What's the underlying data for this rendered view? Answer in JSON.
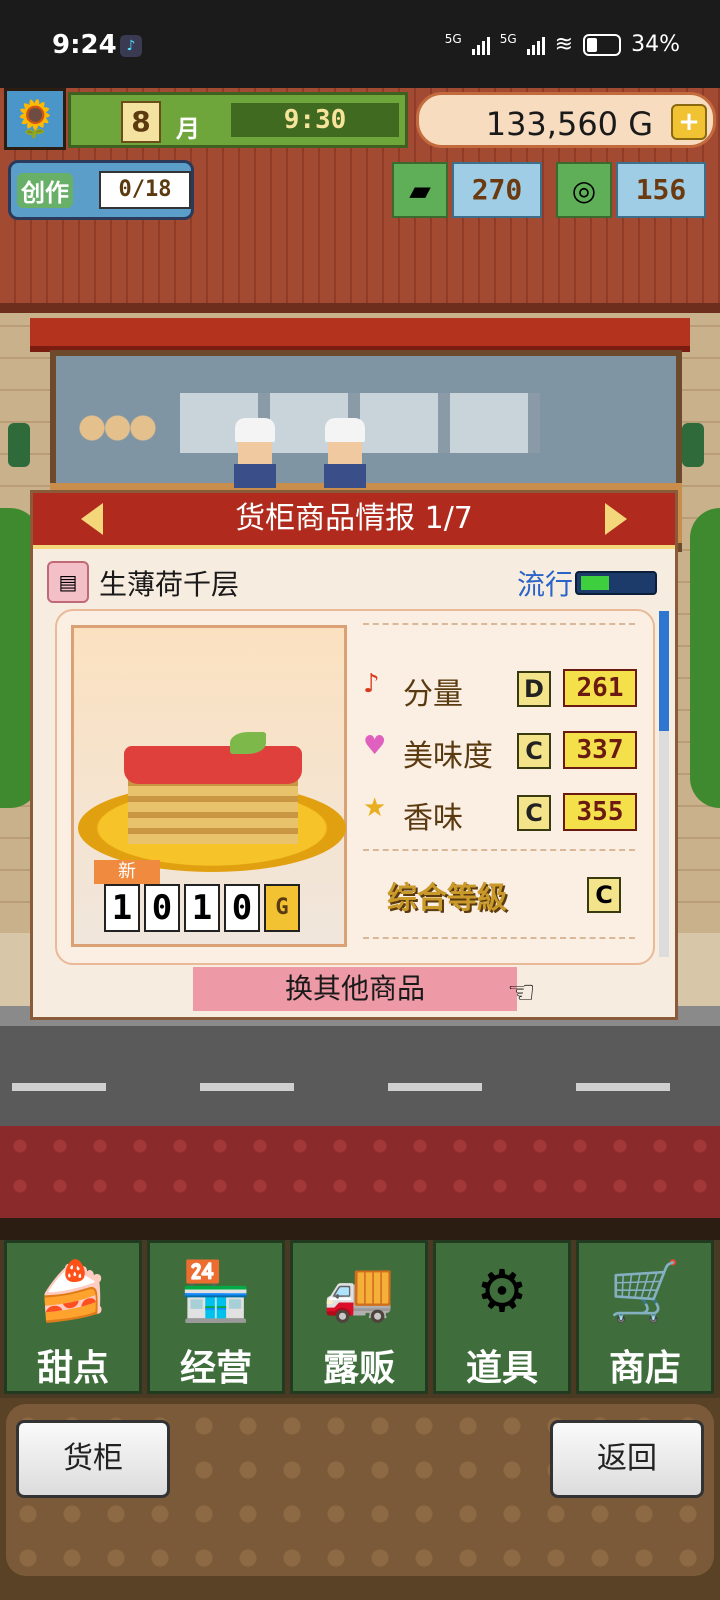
{
  "status_bar": {
    "time": "9:24",
    "network1": "5G",
    "network2": "5G",
    "battery": "34%"
  },
  "hud": {
    "month": "8",
    "month_unit": "月",
    "clock": "9:30",
    "gold": "133,560 G",
    "gold_plus": "+",
    "create_label": "创作",
    "create_count": "0/18",
    "resource1_value": "270",
    "resource2_value": "156"
  },
  "dialog": {
    "title": "货柜商品情报 1/7",
    "item_name": "生薄荷千层",
    "trend_label": "流行",
    "trend_level": 0.4,
    "new_tag": "新",
    "price_digits": [
      "1",
      "0",
      "1",
      "0"
    ],
    "price_unit": "G",
    "stats": [
      {
        "icon": "music-note-icon",
        "glyph": "♪",
        "name": "分量",
        "grade": "D",
        "value": "261"
      },
      {
        "icon": "heart-icon",
        "glyph": "♥",
        "name": "美味度",
        "grade": "C",
        "value": "337"
      },
      {
        "icon": "star-icon",
        "glyph": "★",
        "name": "香味",
        "grade": "C",
        "value": "355"
      }
    ],
    "overall_label": "综合等級",
    "overall_grade": "C",
    "change_button": "换其他商品"
  },
  "nav": [
    {
      "label": "甜点",
      "icon": "cake-icon",
      "glyph": "🍰"
    },
    {
      "label": "经营",
      "icon": "shop-icon",
      "glyph": "🏪"
    },
    {
      "label": "露贩",
      "icon": "truck-icon",
      "glyph": "🚚"
    },
    {
      "label": "道具",
      "icon": "gear-bag-icon",
      "glyph": "⚙"
    },
    {
      "label": "商店",
      "icon": "cart-icon",
      "glyph": "🛒"
    }
  ],
  "footer": {
    "left_button": "货柜",
    "right_button": "返回"
  },
  "colors": {
    "header_red": "#b02b1e",
    "nav_green": "#3f6e3c",
    "trend_blue": "#2a64c8",
    "button_pink": "#ee9aa6"
  }
}
